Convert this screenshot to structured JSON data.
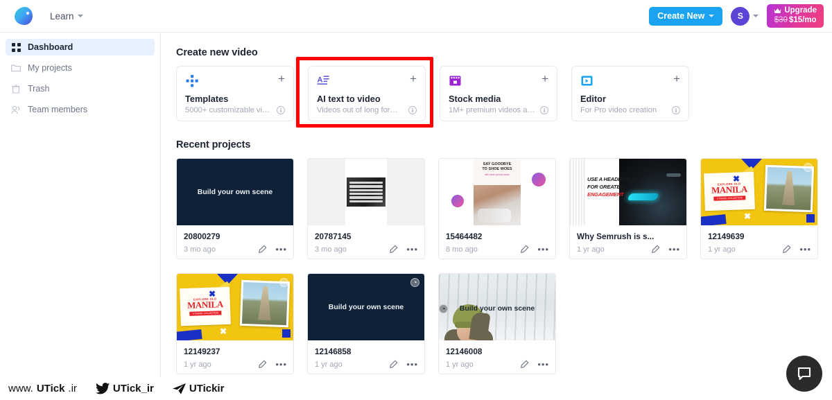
{
  "topbar": {
    "learn_label": "Learn",
    "create_new_label": "Create New",
    "avatar_initial": "S",
    "upgrade_label": "Upgrade",
    "upgrade_old_price": "$30",
    "upgrade_price": "$15/mo"
  },
  "sidebar": {
    "items": [
      {
        "label": "Dashboard",
        "icon": "grid-icon",
        "active": true
      },
      {
        "label": "My projects",
        "icon": "folder-icon",
        "active": false
      },
      {
        "label": "Trash",
        "icon": "trash-icon",
        "active": false
      },
      {
        "label": "Team members",
        "icon": "people-icon",
        "active": false
      }
    ]
  },
  "main": {
    "create_section_title": "Create new video",
    "recent_section_title": "Recent projects",
    "plus_label": "+",
    "info_label": "i",
    "dots_label": "•••",
    "create_cards": [
      {
        "name": "Templates",
        "description": "5000+ customizable vid...",
        "icon": "templates-grid-icon",
        "accent": "#2b7ef0",
        "highlighted": false
      },
      {
        "name": "AI text to video",
        "description": "Videos out of long form t...",
        "icon": "text-to-video-icon",
        "accent": "#5b4fe0",
        "highlighted": true
      },
      {
        "name": "Stock media",
        "description": "1M+ premium videos and...",
        "icon": "stock-media-icon",
        "accent": "#9a23d6",
        "highlighted": false
      },
      {
        "name": "Editor",
        "description": "For Pro video creation",
        "icon": "editor-play-icon",
        "accent": "#1aa3f0",
        "highlighted": false
      }
    ],
    "projects": [
      {
        "name": "20800279",
        "date": "3 mo ago",
        "thumb": "dark-build-scene",
        "overlay_text": "Build your own scene",
        "badge": false
      },
      {
        "name": "20787145",
        "date": "3 mo ago",
        "thumb": "quote-card",
        "overlay_text": "",
        "badge": false
      },
      {
        "name": "15464482",
        "date": "8 mo ago",
        "thumb": "shoe-woes",
        "overlay_text": "",
        "badge": false,
        "art": {
          "headline_line1": "SAY GOODBYE",
          "headline_line2": "TO SHOE WOES",
          "subline": "with these genius hacks"
        }
      },
      {
        "name": "Why Semrush is s...",
        "date": "1 yr ago",
        "thumb": "headline-car",
        "overlay_text": "",
        "badge": false,
        "art": {
          "line1": "USE A HEADLINE",
          "line2": "FOR GREATER",
          "line3": "ENGAGEMENT"
        }
      },
      {
        "name": "12149639",
        "date": "1 yr ago",
        "thumb": "manila",
        "overlay_text": "",
        "badge": false,
        "art": {
          "explore": "EXPLORE OLD",
          "title": "MANILA",
          "sub": "A TRAVEL COLLECTION"
        }
      },
      {
        "name": "12149237",
        "date": "1 yr ago",
        "thumb": "manila",
        "overlay_text": "",
        "badge": false,
        "art": {
          "explore": "EXPLORE OLD",
          "title": "MANILA",
          "sub": "A TRAVEL COLLECTION"
        }
      },
      {
        "name": "12146858",
        "date": "1 yr ago",
        "thumb": "dark-build-scene",
        "overlay_text": "Build your own scene",
        "badge": true
      },
      {
        "name": "12146008",
        "date": "1 yr ago",
        "thumb": "snow-scene",
        "overlay_text": "Build your own scene",
        "badge": true
      }
    ]
  },
  "footer": {
    "site_prefix": "www.",
    "site_bold": "UTick",
    "site_suffix": ".ir",
    "twitter_handle": "UTick_ir",
    "telegram_handle": "UTickir"
  },
  "chat": {
    "label": "chat-bubble-icon"
  },
  "colors": {
    "accent_blue": "#1aa3f0",
    "sidebar_active": "#e8f2fe",
    "upgrade_gradient_start": "#b633d6",
    "upgrade_gradient_end": "#ef3f7e",
    "highlight_red": "#ff0000",
    "avatar_purple": "#5b43d6"
  }
}
